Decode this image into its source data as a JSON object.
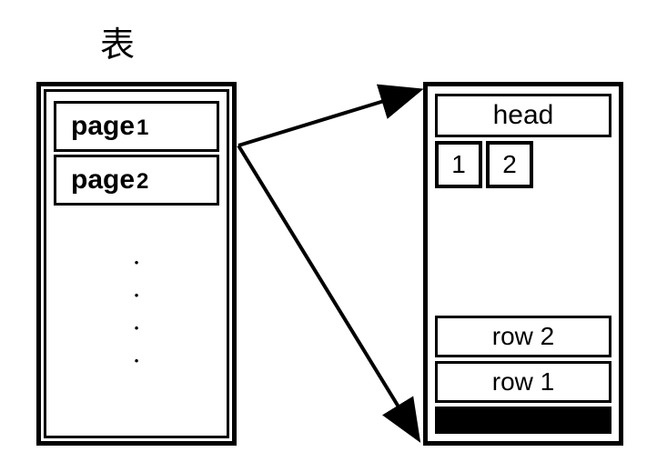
{
  "title": "表",
  "table": {
    "pages": [
      "page1",
      "page2"
    ],
    "ellipsis": "⋮"
  },
  "detail": {
    "head": "head",
    "slots": [
      "1",
      "2"
    ],
    "rows": [
      "row 2",
      "row 1"
    ]
  }
}
